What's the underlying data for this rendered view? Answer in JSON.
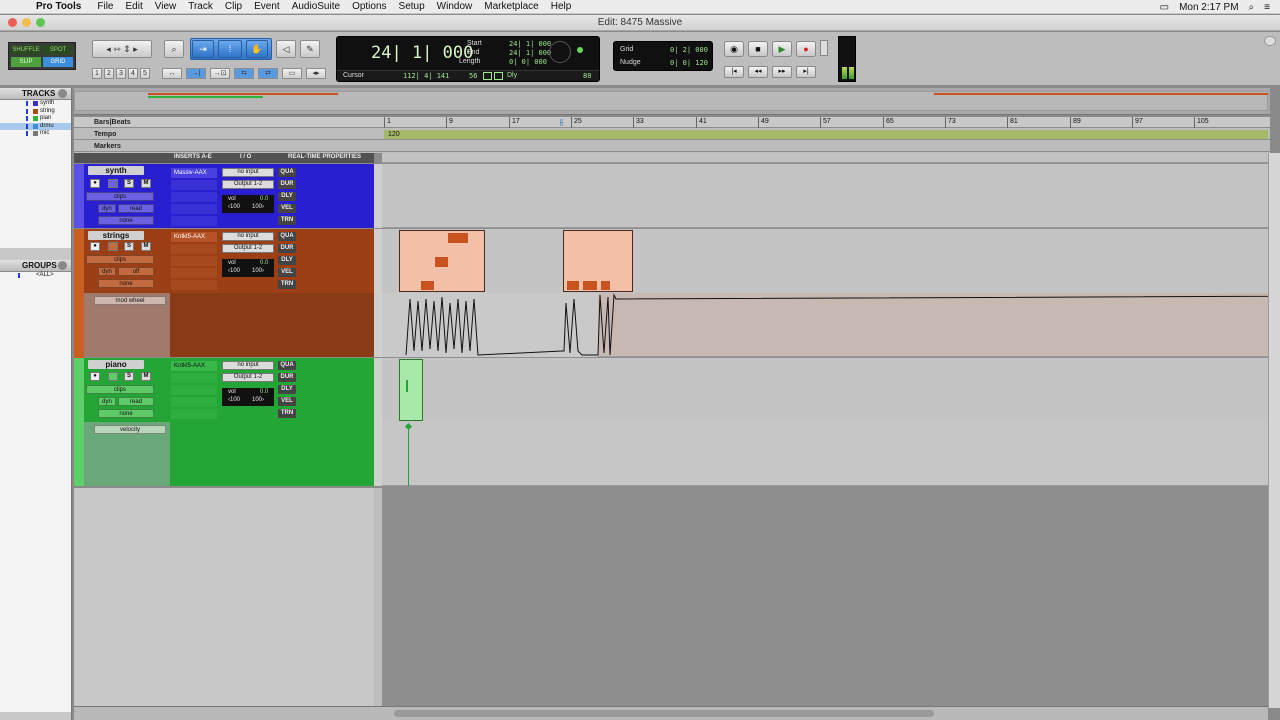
{
  "menubar": {
    "app_name": "Pro Tools",
    "items": [
      "File",
      "Edit",
      "View",
      "Track",
      "Clip",
      "Event",
      "AudioSuite",
      "Options",
      "Setup",
      "Window",
      "Marketplace",
      "Help"
    ],
    "clock": "Mon 2:17 PM"
  },
  "window": {
    "title": "Edit: 8475 Massive"
  },
  "modes": {
    "shuffle": "SHUFFLE",
    "spot": "SPOT",
    "slip": "SLIP",
    "grid": "GRID"
  },
  "zoom_presets": [
    "1",
    "2",
    "3",
    "4",
    "5"
  ],
  "counter": {
    "main": "24| 1| 000",
    "start_label": "Start",
    "start": "24| 1| 000",
    "end_label": "End",
    "end": "24| 1| 000",
    "length_label": "Length",
    "length": "0| 0| 000",
    "cursor_label": "Cursor",
    "cursor": "112| 4| 141",
    "cursor_val": "56",
    "dly": "Dly",
    "tempo_val": "80"
  },
  "grid": {
    "label": "Grid",
    "value": "0| 2| 000"
  },
  "nudge": {
    "label": "Nudge",
    "value": "0| 0| 120"
  },
  "tracks_panel": {
    "header": "TRACKS",
    "items": [
      {
        "name": "synth",
        "color": "#3a2fd6"
      },
      {
        "name": "string",
        "color": "#a24a1c"
      },
      {
        "name": "pian",
        "color": "#2fb33a"
      },
      {
        "name": "drmu",
        "color": "#3b8ed8"
      },
      {
        "name": "mic",
        "color": "#777777"
      }
    ]
  },
  "groups_panel": {
    "header": "GROUPS",
    "all": "<ALL>"
  },
  "rulers": {
    "bars_beats": "Bars|Beats",
    "tempo": "Tempo",
    "markers": "Markers",
    "tempo_value": "120",
    "bars": [
      "1",
      "9",
      "17",
      "25",
      "33",
      "41",
      "49",
      "57",
      "65",
      "73",
      "81",
      "89",
      "97",
      "105"
    ]
  },
  "columns": {
    "inserts": "INSERTS A-E",
    "io": "I / O",
    "rtp": "REAL-TIME PROPERTIES"
  },
  "tracks": [
    {
      "name": "synth",
      "color": "#2a1fd0",
      "light": "#6a62e0",
      "insert": "Massiv-AAX",
      "input": "no input",
      "output": "Output 1-2",
      "clips": "clips",
      "dyn": "dyn",
      "auto": "read",
      "none": "none",
      "vol_label": "vol",
      "vol": "0.0",
      "pan_l": "‹100",
      "pan_r": "100›"
    },
    {
      "name": "strings",
      "color": "#9c3f16",
      "light": "#c26a40",
      "insert": "Kntkt5-AAX",
      "input": "no input",
      "output": "Output 1-2",
      "clips": "clips",
      "dyn": "dyn",
      "auto": "off",
      "none": "none",
      "vol_label": "vol",
      "vol": "0.0",
      "pan_l": "‹100",
      "pan_r": "100›",
      "lane": "mod wheel"
    },
    {
      "name": "piano",
      "color": "#23a636",
      "light": "#5ecb68",
      "insert": "Kntkt5-AAX",
      "input": "no input",
      "output": "Output 1-2",
      "clips": "clips",
      "dyn": "dyn",
      "auto": "read",
      "none": "none",
      "vol_label": "vol",
      "vol": "0.0",
      "pan_l": "‹100",
      "pan_r": "100›",
      "lane": "velocity"
    }
  ],
  "rtp_buttons": [
    "QUA",
    "DUR",
    "DLY",
    "VEL",
    "TRN"
  ],
  "rsm": {
    "s": "S",
    "m": "M"
  }
}
